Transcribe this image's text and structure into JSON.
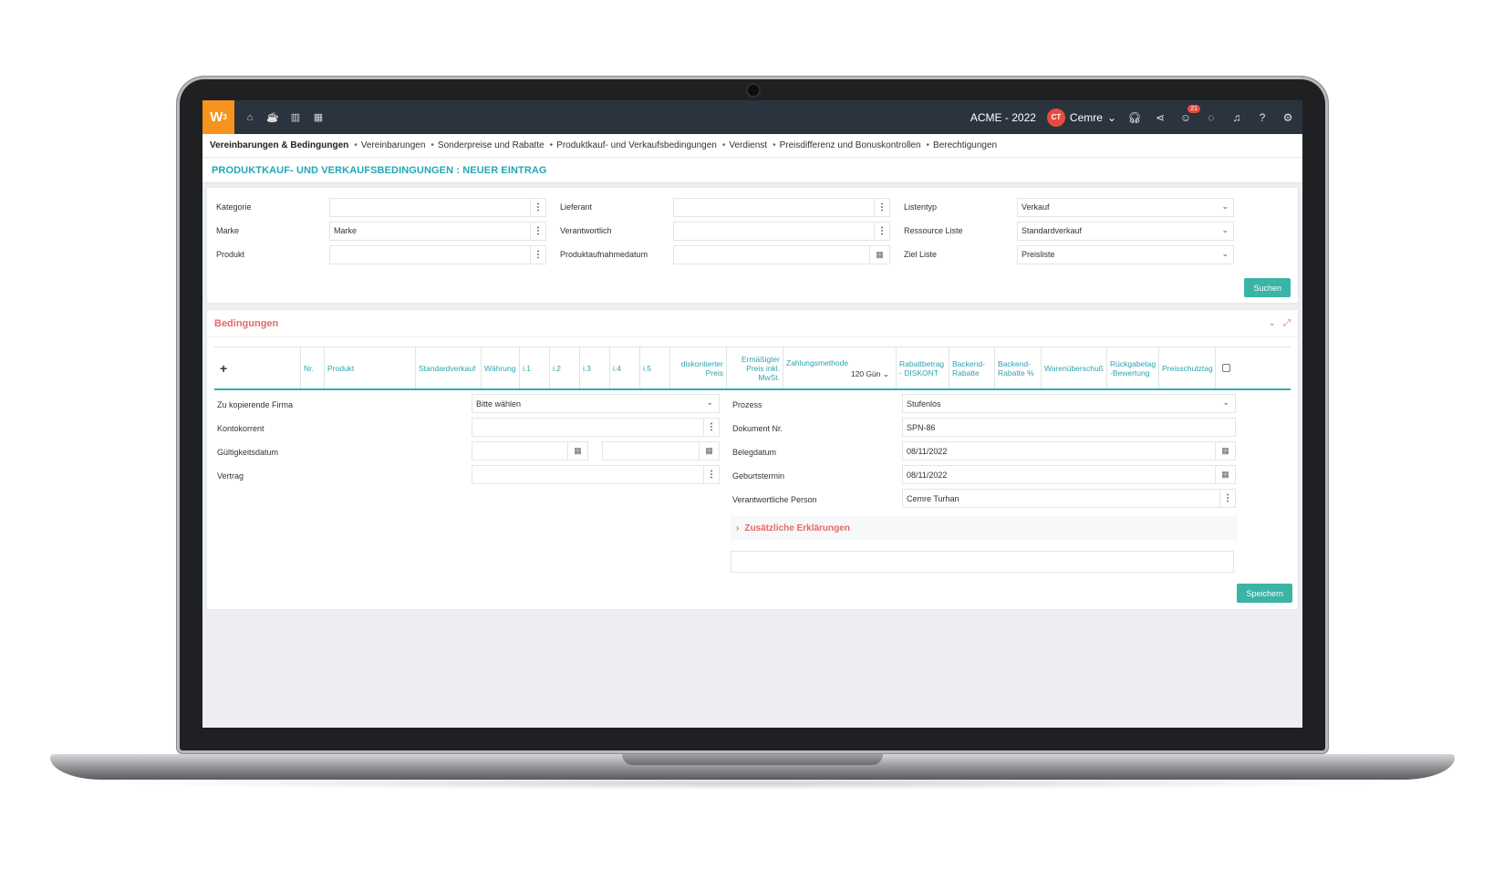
{
  "appbar": {
    "logo": "W",
    "logo_sup": "3",
    "company": "ACME - 2022",
    "avatar_initials": "CT",
    "user_name": "Cemre",
    "notification_count": "21"
  },
  "crumbs": [
    "Vereinbarungen & Bedingungen",
    "Vereinbarungen",
    "Sonderpreise und Rabatte",
    "Produktkauf- und Verkaufsbedingungen",
    "Verdienst",
    "Preisdifferenz und Bonuskontrollen",
    "Berechtigungen"
  ],
  "page_title": "PRODUKTKAUF- UND VERKAUFSBEDINGUNGEN : NEUER EINTRAG",
  "filters": {
    "kategorie_label": "Kategorie",
    "kategorie_value": "",
    "marke_label": "Marke",
    "marke_value": "Marke",
    "produkt_label": "Produkt",
    "produkt_value": "",
    "lieferant_label": "Lieferant",
    "lieferant_value": "",
    "verantwortlich_label": "Verantwortlich",
    "verantwortlich_value": "",
    "produktaufnahmedatum_label": "Produktaufnahmedatum",
    "produktaufnahmedatum_value": "",
    "listentyp_label": "Listentyp",
    "listentyp_value": "Verkauf",
    "ressource_label": "Ressource Liste",
    "ressource_value": "Standardverkauf",
    "ziel_label": "Ziel Liste",
    "ziel_value": "Preisliste",
    "search_button": "Suchen"
  },
  "conditions": {
    "title": "Bedingungen",
    "columns": [
      "Nr.",
      "Produkt",
      "Standardverkauf",
      "Währung",
      "i.1",
      "i.2",
      "i.3",
      "i.4",
      "i.5",
      "diskontierter Preis",
      "Ermäßigter Preis inkl. MwSt.",
      "Zahlungsmethode",
      "Rabattbetrag - DISKONT",
      "Backend-Rabatte",
      "Backend-Rabatte %",
      "Warenüberschuß",
      "Rückgabetag -Bewertung",
      "Preisschutztag"
    ],
    "payment_default": "120 Gün"
  },
  "form": {
    "firma_label": "Zu kopierende Firma",
    "firma_value": "Bitte wählen",
    "konto_label": "Kontokorrent",
    "konto_value": "",
    "gueltig_label": "Gültigkeitsdatum",
    "gueltig_from": "",
    "gueltig_to": "",
    "vertrag_label": "Vertrag",
    "vertrag_value": "",
    "prozess_label": "Prozess",
    "prozess_value": "Stufenlos",
    "dokument_label": "Dokument Nr.",
    "dokument_value": "SPN-86",
    "beleg_label": "Belegdatum",
    "beleg_value": "08/11/2022",
    "geburt_label": "Geburtstermin",
    "geburt_value": "08/11/2022",
    "person_label": "Verantwortliche Person",
    "person_value": "Cemre Turhan",
    "extra_label": "Zusätzliche Erklärungen",
    "save_button": "Speichern"
  }
}
